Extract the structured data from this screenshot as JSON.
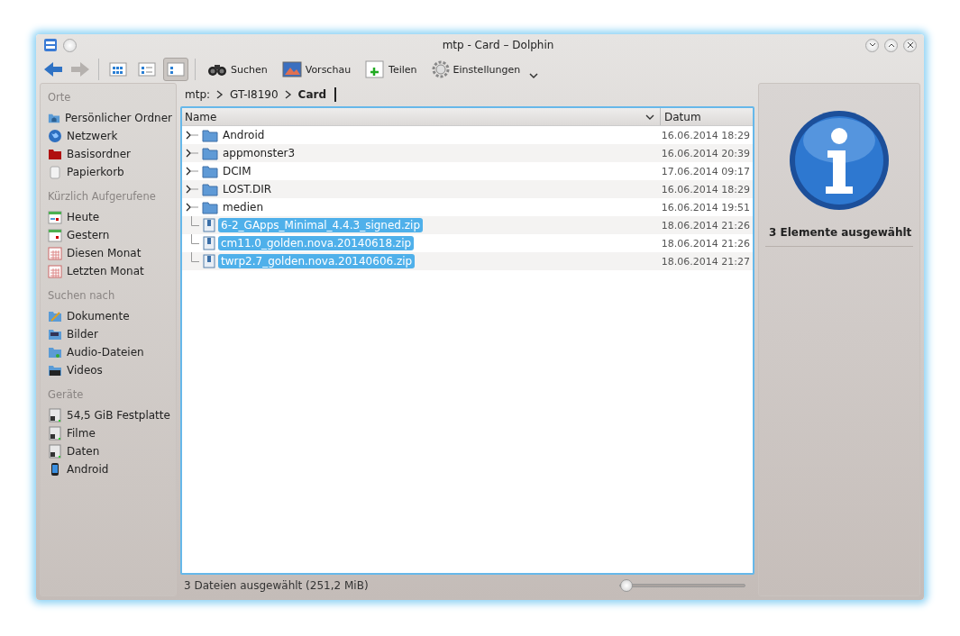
{
  "window": {
    "title": "mtp - Card – Dolphin"
  },
  "toolbar": {
    "view_modes": [
      {
        "kind": "icons",
        "selected": false
      },
      {
        "kind": "compact",
        "selected": false
      },
      {
        "kind": "details",
        "selected": true
      }
    ],
    "actions": [
      {
        "kind": "search",
        "label": "Suchen"
      },
      {
        "kind": "preview",
        "label": "Vorschau"
      },
      {
        "kind": "split",
        "label": "Teilen"
      },
      {
        "kind": "settings",
        "label": "Einstellungen"
      }
    ]
  },
  "sidebar": {
    "sections": [
      {
        "title": "Orte",
        "items": [
          {
            "kind": "home",
            "label": "Persönlicher Ordner"
          },
          {
            "kind": "network",
            "label": "Netzwerk"
          },
          {
            "kind": "root",
            "label": "Basisordner"
          },
          {
            "kind": "trash",
            "label": "Papierkorb"
          }
        ]
      },
      {
        "title": "Kürzlich Aufgerufene",
        "items": [
          {
            "kind": "today",
            "label": "Heute"
          },
          {
            "kind": "yesterday",
            "label": "Gestern"
          },
          {
            "kind": "month",
            "label": "Diesen Monat"
          },
          {
            "kind": "month",
            "label": "Letzten Monat"
          }
        ]
      },
      {
        "title": "Suchen nach",
        "items": [
          {
            "kind": "documents",
            "label": "Dokumente"
          },
          {
            "kind": "images",
            "label": "Bilder"
          },
          {
            "kind": "audio",
            "label": "Audio-Dateien"
          },
          {
            "kind": "videos",
            "label": "Videos"
          }
        ]
      },
      {
        "title": "Geräte",
        "items": [
          {
            "kind": "drive",
            "label": "54,5 GiB Festplatte"
          },
          {
            "kind": "drive",
            "label": "Filme"
          },
          {
            "kind": "drive",
            "label": "Daten"
          },
          {
            "kind": "phone",
            "label": "Android"
          }
        ]
      }
    ]
  },
  "breadcrumb": [
    "mtp:",
    "GT-I8190",
    "Card"
  ],
  "table": {
    "columns": [
      "Name",
      "Datum"
    ],
    "rows": [
      {
        "kind": "folder",
        "name": "Android",
        "date": "16.06.2014 18:29",
        "selected": false
      },
      {
        "kind": "folder",
        "name": "appmonster3",
        "date": "16.06.2014 20:39",
        "selected": false
      },
      {
        "kind": "folder",
        "name": "DCIM",
        "date": "17.06.2014 09:17",
        "selected": false
      },
      {
        "kind": "folder",
        "name": "LOST.DIR",
        "date": "16.06.2014 18:29",
        "selected": false
      },
      {
        "kind": "folder",
        "name": "medien",
        "date": "16.06.2014 19:51",
        "selected": false
      },
      {
        "kind": "file",
        "name": "6-2_GApps_Minimal_4.4.3_signed.zip",
        "date": "18.06.2014 21:26",
        "selected": true
      },
      {
        "kind": "file",
        "name": "cm11.0_golden.nova.20140618.zip",
        "date": "18.06.2014 21:26",
        "selected": true
      },
      {
        "kind": "file",
        "name": "twrp2.7_golden.nova.20140606.zip",
        "date": "18.06.2014 21:27",
        "selected": true
      }
    ]
  },
  "status_bar": {
    "text": "3 Dateien ausgewählt (251,2 MiB)",
    "zoom": {
      "level": 0.05
    }
  },
  "info_panel": {
    "summary": "3 Elemente ausgewählt"
  }
}
